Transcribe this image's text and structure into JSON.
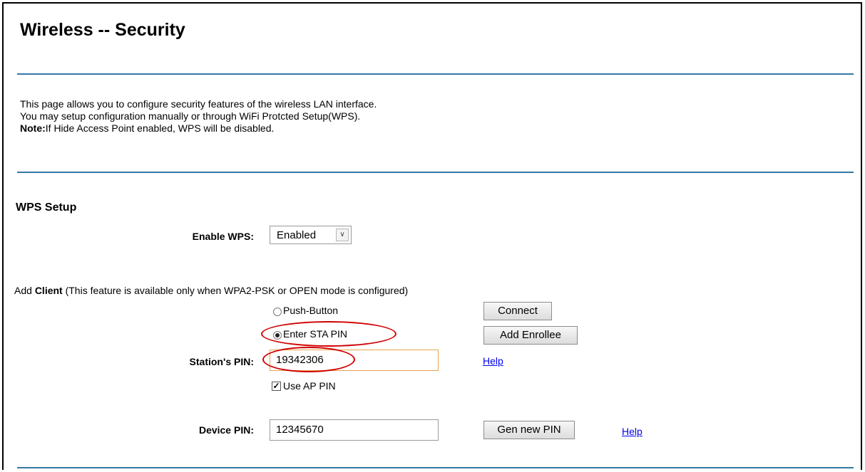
{
  "page": {
    "title": "Wireless -- Security",
    "description_line1": "This page allows you to configure security features of the wireless LAN interface.",
    "description_line2": "You may setup configuration manually or through WiFi Protcted Setup(WPS).",
    "note_label": "Note:",
    "note_text": "If Hide Access Point enabled, WPS will be disabled."
  },
  "wps": {
    "section_title": "WPS Setup",
    "enable_label": "Enable WPS:",
    "enable_value": "Enabled",
    "add_client_prefix": "Add ",
    "add_client_bold": "Client",
    "add_client_suffix": " (This feature is available only when WPA2-PSK or OPEN mode is configured)",
    "push_button_label": "Push-Button",
    "push_button_selected": false,
    "enter_pin_label": "Enter STA PIN",
    "enter_pin_selected": true,
    "connect_button": "Connect",
    "add_enrollee_button": "Add Enrollee",
    "station_pin_label": "Station's PIN:",
    "station_pin_value": "19342306",
    "help_label": "Help",
    "use_ap_pin_label": "Use AP PIN",
    "use_ap_pin_checked": true,
    "device_pin_label": "Device PIN:",
    "device_pin_value": "12345670",
    "gen_pin_button": "Gen new PIN",
    "help_label_2": "Help"
  },
  "colors": {
    "divider": "#3478a6",
    "highlight_ellipse": "#d00000",
    "link": "#0000ee"
  },
  "icons": {
    "select_arrow": "chevron-down-icon",
    "checkbox_mark": "checkmark-icon"
  }
}
